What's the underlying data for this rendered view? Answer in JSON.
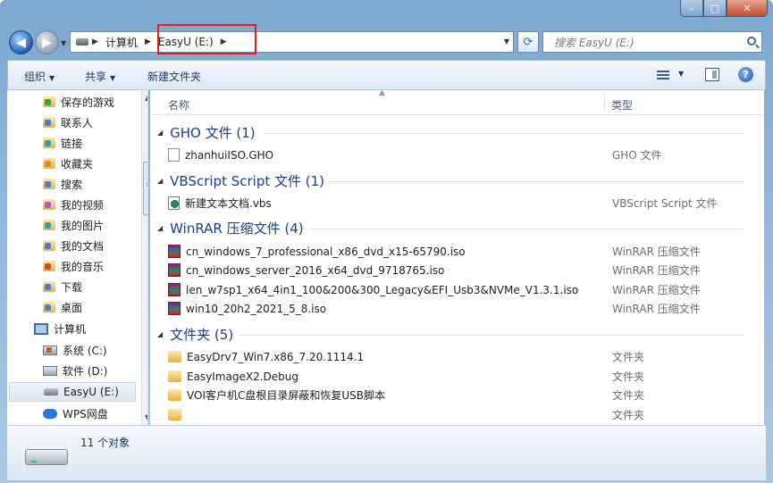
{
  "window": {
    "caption_buttons": {
      "minimize": "–",
      "maximize": "□",
      "close": "✕"
    }
  },
  "nav": {
    "back_icon": "arrow-left-icon",
    "forward_icon": "arrow-right-icon"
  },
  "address": {
    "crumbs": [
      "计算机",
      "EasyU (E:)"
    ]
  },
  "search": {
    "placeholder": "搜索 EasyU (E:)"
  },
  "toolbar": {
    "organize": "组织",
    "share": "共享",
    "new_folder": "新建文件夹"
  },
  "sidebar": {
    "items": [
      {
        "label": "保存的游戏",
        "icon": "folder-games-icon"
      },
      {
        "label": "联系人",
        "icon": "folder-contacts-icon"
      },
      {
        "label": "链接",
        "icon": "folder-links-icon"
      },
      {
        "label": "收藏夹",
        "icon": "folder-favorites-icon"
      },
      {
        "label": "搜索",
        "icon": "folder-search-icon"
      },
      {
        "label": "我的视频",
        "icon": "folder-videos-icon"
      },
      {
        "label": "我的图片",
        "icon": "folder-pictures-icon"
      },
      {
        "label": "我的文档",
        "icon": "folder-documents-icon"
      },
      {
        "label": "我的音乐",
        "icon": "folder-music-icon"
      },
      {
        "label": "下载",
        "icon": "folder-downloads-icon"
      },
      {
        "label": "桌面",
        "icon": "folder-desktop-icon"
      },
      {
        "label": "计算机",
        "icon": "computer-icon"
      },
      {
        "label": "系统 (C:)",
        "icon": "drive-c-icon"
      },
      {
        "label": "软件 (D:)",
        "icon": "drive-d-icon"
      },
      {
        "label": "EasyU (E:)",
        "icon": "usb-drive-icon"
      },
      {
        "label": "WPS网盘",
        "icon": "cloud-drive-icon"
      }
    ]
  },
  "columns": {
    "name": "名称",
    "type": "类型"
  },
  "groups": [
    {
      "title": "GHO 文件 (1)",
      "files": [
        {
          "name": "zhanhuiISO.GHO",
          "type": "GHO 文件",
          "icon": "file-icon"
        }
      ]
    },
    {
      "title": "VBScript Script 文件 (1)",
      "files": [
        {
          "name": "新建文本文档.vbs",
          "type": "VBScript Script 文件",
          "icon": "vbscript-file-icon"
        }
      ]
    },
    {
      "title": "WinRAR 压缩文件 (4)",
      "files": [
        {
          "name": "cn_windows_7_professional_x86_dvd_x15-65790.iso",
          "type": "WinRAR 压缩文件",
          "icon": "winrar-archive-icon"
        },
        {
          "name": "cn_windows_server_2016_x64_dvd_9718765.iso",
          "type": "WinRAR 压缩文件",
          "icon": "winrar-archive-icon"
        },
        {
          "name": "len_w7sp1_x64_4in1_100&200&300_Legacy&EFI_Usb3&NVMe_V1.3.1.iso",
          "type": "WinRAR 压缩文件",
          "icon": "winrar-archive-icon"
        },
        {
          "name": "win10_20h2_2021_5_8.iso",
          "type": "WinRAR 压缩文件",
          "icon": "winrar-archive-icon"
        }
      ]
    },
    {
      "title": "文件夹 (5)",
      "files": [
        {
          "name": "EasyDrv7_Win7.x86_7.20.1114.1",
          "type": "文件夹",
          "icon": "folder-icon"
        },
        {
          "name": "EasyImageX2.Debug",
          "type": "文件夹",
          "icon": "folder-icon"
        },
        {
          "name": "VOI客户机C盘根目录屏蔽和恢复USB脚本",
          "type": "文件夹",
          "icon": "folder-icon"
        },
        {
          "name": "",
          "type": "文件夹",
          "icon": "folder-icon"
        }
      ]
    }
  ],
  "status": {
    "count": "11 个对象"
  }
}
